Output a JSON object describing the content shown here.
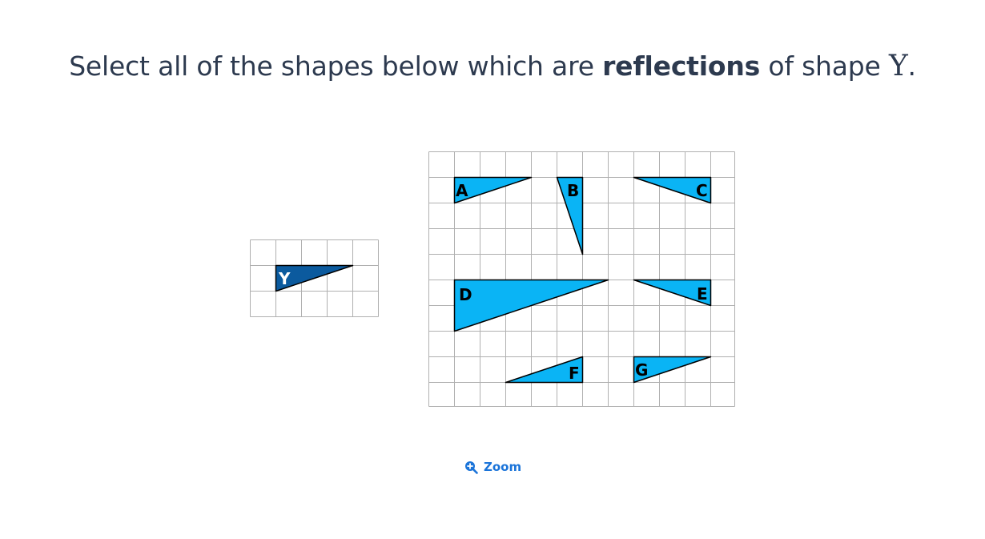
{
  "question": {
    "prefix": "Select all of the shapes below which are ",
    "bold": "reflections",
    "suffix": " of shape ",
    "var": "Y",
    "end": "."
  },
  "reference_shape": {
    "label": "Y",
    "fill": "#0b5a9e",
    "label_color": "#ffffff"
  },
  "options": [
    {
      "label": "A"
    },
    {
      "label": "B"
    },
    {
      "label": "C"
    },
    {
      "label": "D"
    },
    {
      "label": "E"
    },
    {
      "label": "F"
    },
    {
      "label": "G"
    }
  ],
  "colors": {
    "option_fill": "#0ab4f5",
    "grid_line": "#b0b0b0",
    "outline": "#000000",
    "accent": "#1b74d9"
  },
  "zoom": {
    "label": "Zoom",
    "icon": "zoom-in-icon"
  }
}
